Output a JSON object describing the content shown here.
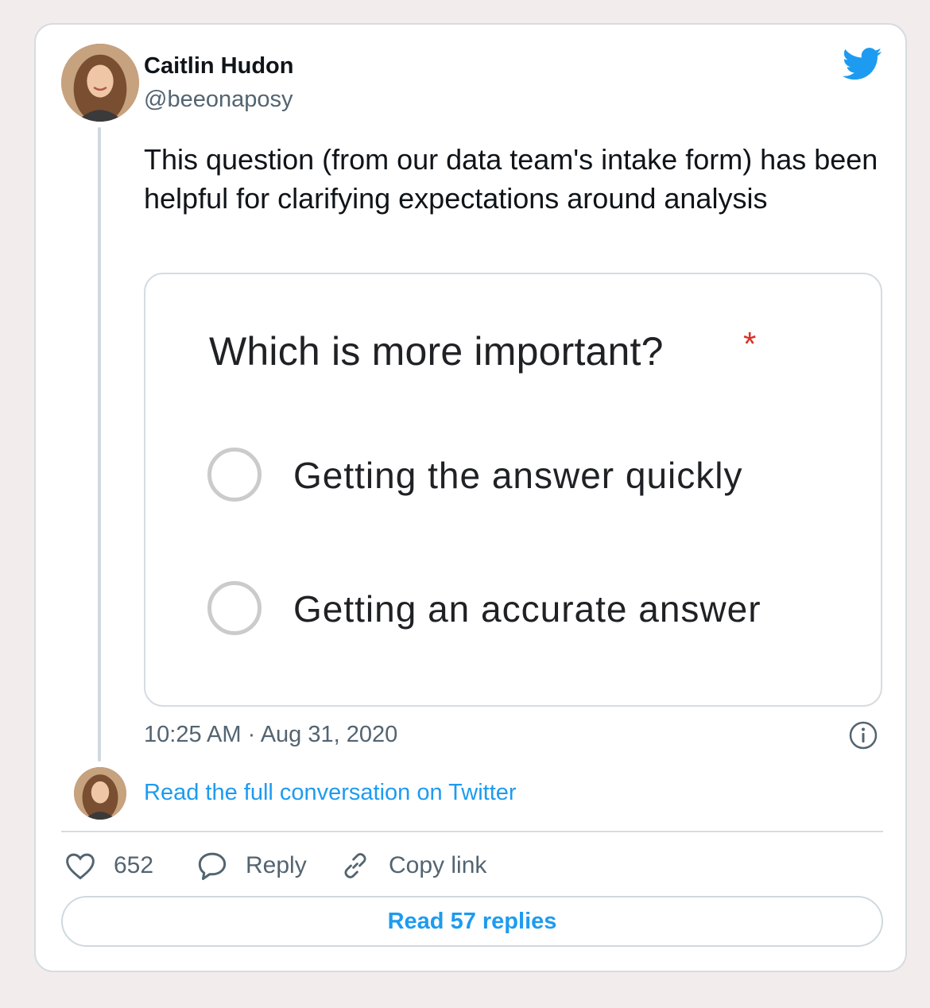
{
  "tweet": {
    "author_name": "Caitlin Hudon",
    "author_handle": "@beeonaposy",
    "text": "This question (from our data team's intake form) has been helpful for clarifying expectations around analysis",
    "timestamp": "10:25 AM · Aug 31, 2020",
    "read_conversation": "Read the full conversation on Twitter"
  },
  "media": {
    "question": "Which is more important?",
    "required_mark": "*",
    "options": [
      {
        "label": "Getting the answer quickly"
      },
      {
        "label": "Getting an accurate answer"
      }
    ]
  },
  "actions": {
    "like_count": "652",
    "reply_label": "Reply",
    "copy_link_label": "Copy link",
    "read_replies_label": "Read 57 replies"
  },
  "icons": {
    "brand": "twitter-bird-icon",
    "info": "info-icon",
    "like": "heart-icon",
    "reply": "speech-bubble-icon",
    "copy": "link-icon"
  },
  "colors": {
    "accent": "#1d9bf0",
    "text": "#0f1419",
    "muted": "#536471",
    "required": "#d93025",
    "background": "#f3ecec"
  }
}
